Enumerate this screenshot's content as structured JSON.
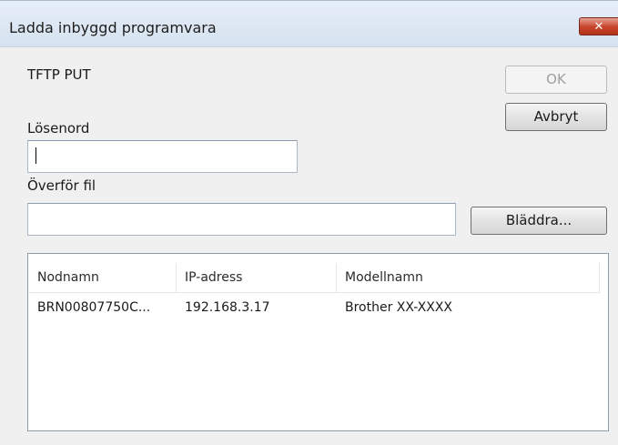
{
  "window": {
    "title": "Ladda inbyggd programvara",
    "close_label": "✕"
  },
  "form": {
    "protocol_label": "TFTP PUT",
    "password_label": "Lösenord",
    "password_value": "",
    "transfer_file_label": "Överför fil",
    "transfer_file_value": ""
  },
  "buttons": {
    "ok": "OK",
    "cancel": "Avbryt",
    "browse": "Bläddra..."
  },
  "devices": {
    "columns": [
      "Nodnamn",
      "IP-adress",
      "Modellnamn"
    ],
    "rows": [
      [
        "BRN00807750C...",
        "192.168.3.17",
        "Brother XX-XXXX"
      ]
    ]
  }
}
